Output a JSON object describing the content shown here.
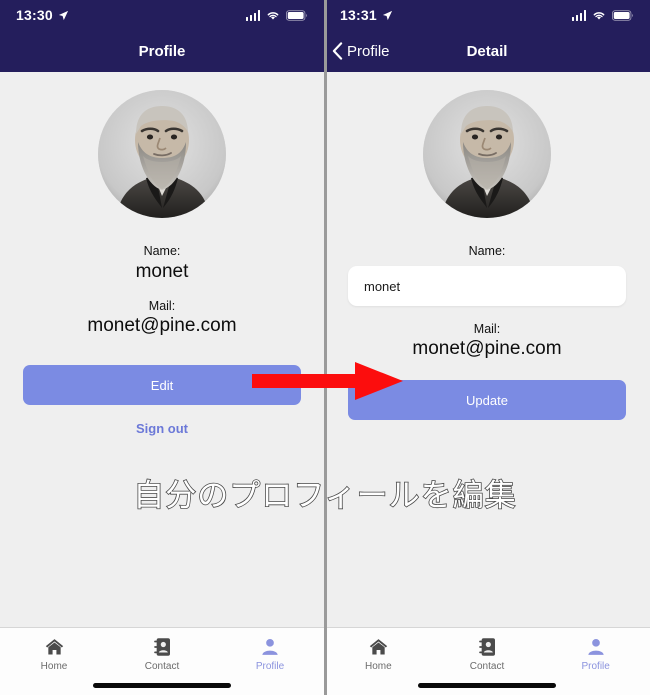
{
  "left_panel": {
    "status_bar": {
      "time": "13:30",
      "location_icon": "location-arrow-icon",
      "signal_icon": "cellular-signal-icon",
      "wifi_icon": "wifi-icon",
      "battery_icon": "battery-full-icon"
    },
    "nav": {
      "title": "Profile"
    },
    "avatar": {
      "name": "user-avatar-photo"
    },
    "name_label": "Name:",
    "name_value": "monet",
    "mail_label": "Mail:",
    "mail_value": "monet@pine.com",
    "edit_button": "Edit",
    "sign_out_link": "Sign out",
    "tabs": [
      {
        "label": "Home",
        "icon": "home-icon",
        "active": false
      },
      {
        "label": "Contact",
        "icon": "address-book-icon",
        "active": false
      },
      {
        "label": "Profile",
        "icon": "person-icon",
        "active": true
      }
    ]
  },
  "right_panel": {
    "status_bar": {
      "time": "13:31",
      "location_icon": "location-arrow-icon",
      "signal_icon": "cellular-signal-icon",
      "wifi_icon": "wifi-icon",
      "battery_icon": "battery-full-icon"
    },
    "nav": {
      "back_label": "Profile",
      "title": "Detail"
    },
    "avatar": {
      "name": "user-avatar-photo"
    },
    "name_label": "Name:",
    "name_input_value": "monet",
    "name_input_placeholder": "Name",
    "mail_label": "Mail:",
    "mail_value": "monet@pine.com",
    "update_button": "Update",
    "tabs": [
      {
        "label": "Home",
        "icon": "home-icon",
        "active": false
      },
      {
        "label": "Contact",
        "icon": "address-book-icon",
        "active": false
      },
      {
        "label": "Profile",
        "icon": "person-icon",
        "active": true
      }
    ]
  },
  "annotation": {
    "caption": "自分のプロフィールを編集",
    "arrow": "red-right-arrow",
    "arrow_color": "#FC0D0D"
  },
  "colors": {
    "nav_navy": "#241E5C",
    "screen_bg": "#efefef",
    "button_periwinkle": "#7B8BE3",
    "link_purple": "#6C79D8",
    "tab_active": "#8B93DE",
    "annotation_red": "#FC0D0D"
  }
}
